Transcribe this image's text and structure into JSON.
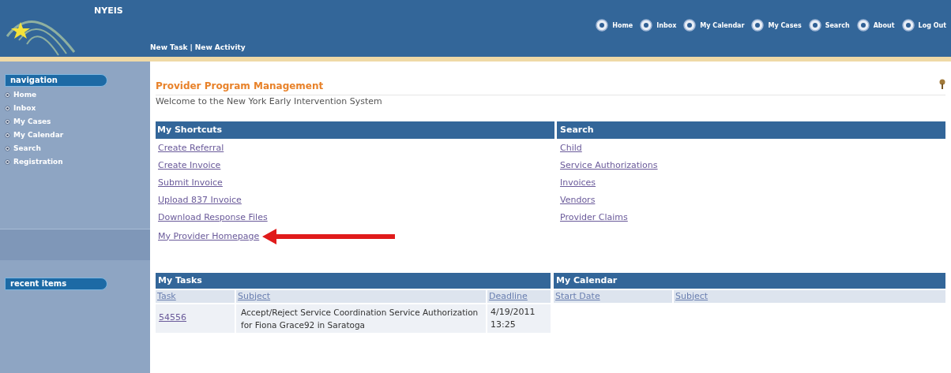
{
  "header": {
    "logo_text": "NYEIS",
    "top_nav": [
      "Home",
      "Inbox",
      "My Calendar",
      "My Cases",
      "Search",
      "About",
      "Log Out"
    ],
    "actions": [
      "New Task",
      "New Activity"
    ],
    "separator": "|"
  },
  "sidebar": {
    "navigation_title": "navigation",
    "navigation_items": [
      "Home",
      "Inbox",
      "My Cases",
      "My Calendar",
      "Search",
      "Registration"
    ],
    "recent_title": "recent items"
  },
  "page": {
    "title": "Provider Program Management",
    "welcome": "Welcome to the New York Early Intervention System"
  },
  "shortcuts": {
    "title": "My Shortcuts",
    "links": [
      {
        "label": "Create Referral",
        "marked": false
      },
      {
        "label": "Create Invoice",
        "marked": false
      },
      {
        "label": "Submit Invoice",
        "marked": false
      },
      {
        "label": "Upload 837 Invoice",
        "marked": false
      },
      {
        "label": "Download Response Files",
        "marked": false
      },
      {
        "label": "My Provider Homepage",
        "marked": true
      }
    ]
  },
  "search": {
    "title": "Search",
    "links": [
      "Child",
      "Service Authorizations",
      "Invoices",
      "Vendors",
      "Provider Claims"
    ]
  },
  "tasks": {
    "title": "My Tasks",
    "columns": [
      "Task",
      "Subject",
      "Deadline"
    ],
    "rows": [
      {
        "task": "54556",
        "subject": "Accept/Reject Service Coordination Service Authorization for Fiona Grace92 in Saratoga",
        "deadline": "4/19/2011 13:25"
      }
    ]
  },
  "calendar": {
    "title": "My Calendar",
    "columns": [
      "Start Date",
      "Subject"
    ]
  }
}
